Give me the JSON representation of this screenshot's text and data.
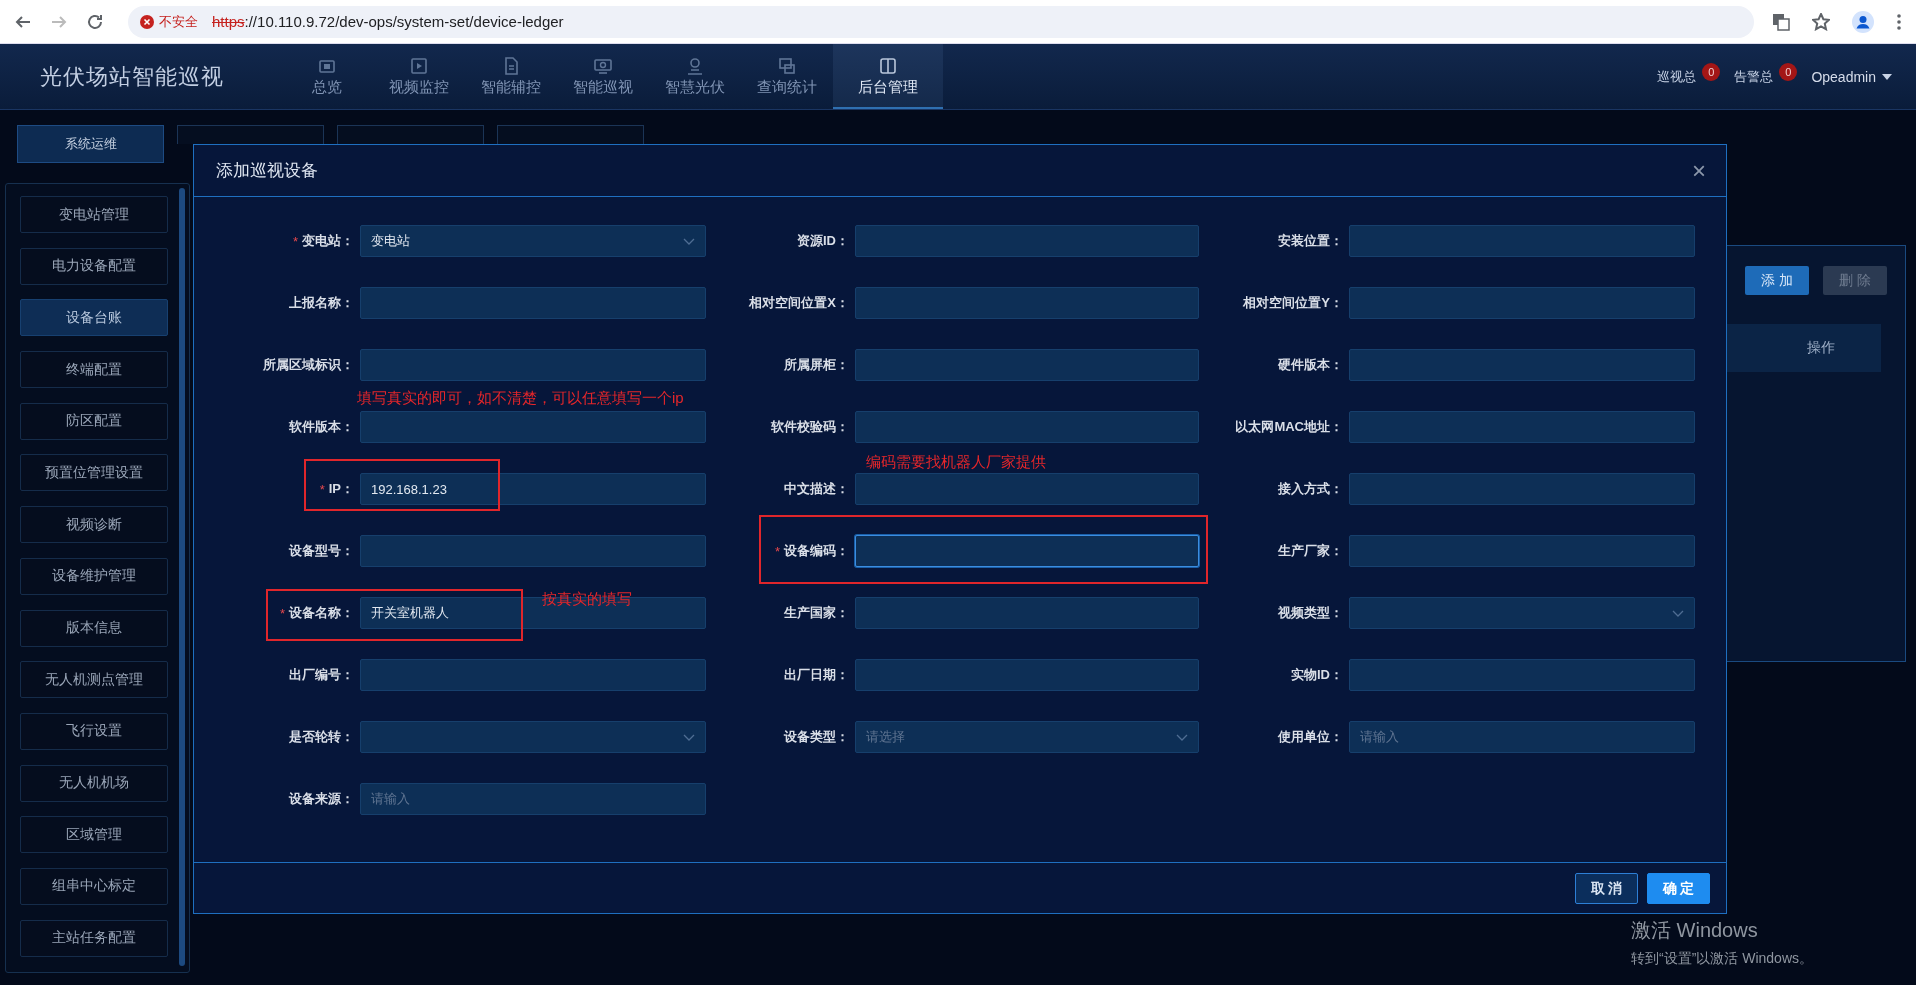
{
  "browser": {
    "security": "不安全",
    "url_scheme": "https",
    "url_rest": "://10.110.9.72/dev-ops/system-set/device-ledger"
  },
  "app": {
    "title": "光伏场站智能巡视",
    "nav": [
      {
        "label": "总览",
        "selected": false
      },
      {
        "label": "视频监控",
        "selected": false
      },
      {
        "label": "智能辅控",
        "selected": false
      },
      {
        "label": "智能巡视",
        "selected": false
      },
      {
        "label": "智慧光伏",
        "selected": false
      },
      {
        "label": "查询统计",
        "selected": false
      },
      {
        "label": "后台管理",
        "selected": true
      }
    ],
    "counters": [
      {
        "label": "巡视总",
        "count": "0"
      },
      {
        "label": "告警总",
        "count": "0"
      }
    ],
    "user": "Opeadmin"
  },
  "tabs": [
    {
      "label": "系统运维",
      "selected": true
    },
    {
      "selected": false
    },
    {
      "selected": false
    },
    {
      "selected": false
    }
  ],
  "sidebar": {
    "items": [
      {
        "label": "变电站管理",
        "selected": false
      },
      {
        "label": "电力设备配置",
        "selected": false
      },
      {
        "label": "设备台账",
        "selected": true
      },
      {
        "label": "终端配置",
        "selected": false
      },
      {
        "label": "防区配置",
        "selected": false
      },
      {
        "label": "预置位管理设置",
        "selected": false
      },
      {
        "label": "视频诊断",
        "selected": false
      },
      {
        "label": "设备维护管理",
        "selected": false
      },
      {
        "label": "版本信息",
        "selected": false
      },
      {
        "label": "无人机测点管理",
        "selected": false
      },
      {
        "label": "飞行设置",
        "selected": false
      },
      {
        "label": "无人机机场",
        "selected": false
      },
      {
        "label": "区域管理",
        "selected": false
      },
      {
        "label": "组串中心标定",
        "selected": false
      },
      {
        "label": "主站任务配置",
        "selected": false
      }
    ]
  },
  "panel": {
    "buttons": [
      {
        "label": "添 加",
        "disabled": false
      },
      {
        "label": "删 除",
        "disabled": true
      }
    ],
    "columns": [
      "操作"
    ]
  },
  "dialog": {
    "title": "添加巡视设备",
    "close": "×",
    "required_mark": "*",
    "fields": [
      {
        "label": "变电站：",
        "kind": "select",
        "value": "变电站",
        "required": true,
        "focused": false
      },
      {
        "label": "资源ID：",
        "kind": "input",
        "required": false,
        "focused": false
      },
      {
        "label": "安装位置：",
        "kind": "input",
        "required": false,
        "focused": false
      },
      {
        "label": "上报名称：",
        "kind": "input",
        "required": false,
        "focused": false
      },
      {
        "label": "相对空间位置X：",
        "kind": "input",
        "required": false,
        "focused": false
      },
      {
        "label": "相对空间位置Y：",
        "kind": "input",
        "required": false,
        "focused": false
      },
      {
        "label": "所属区域标识：",
        "kind": "input",
        "required": false,
        "focused": false
      },
      {
        "label": "所属屏柜：",
        "kind": "input",
        "required": false,
        "focused": false
      },
      {
        "label": "硬件版本：",
        "kind": "input",
        "required": false,
        "focused": false
      },
      {
        "label": "软件版本：",
        "kind": "input",
        "required": false,
        "focused": false
      },
      {
        "label": "软件校验码：",
        "kind": "input",
        "required": false,
        "focused": false
      },
      {
        "label": "以太网MAC地址：",
        "kind": "input",
        "required": false,
        "focused": false
      },
      {
        "label": "IP：",
        "kind": "input",
        "value": "192.168.1.23",
        "required": true,
        "focused": false
      },
      {
        "label": "中文描述：",
        "kind": "input",
        "required": false,
        "focused": false
      },
      {
        "label": "接入方式：",
        "kind": "input",
        "required": false,
        "focused": false
      },
      {
        "label": "设备型号：",
        "kind": "input",
        "required": false,
        "focused": false
      },
      {
        "label": "设备编码：",
        "kind": "input",
        "required": true,
        "focused": true
      },
      {
        "label": "生产厂家：",
        "kind": "input",
        "required": false,
        "focused": false
      },
      {
        "label": "设备名称：",
        "kind": "input",
        "value": "开关室机器人",
        "required": true,
        "focused": false
      },
      {
        "label": "生产国家：",
        "kind": "input",
        "required": false,
        "focused": false
      },
      {
        "label": "视频类型：",
        "kind": "select",
        "required": false,
        "focused": false
      },
      {
        "label": "出厂编号：",
        "kind": "input",
        "required": false,
        "focused": false
      },
      {
        "label": "出厂日期：",
        "kind": "input",
        "required": false,
        "focused": false
      },
      {
        "label": "实物ID：",
        "kind": "input",
        "required": false,
        "focused": false
      },
      {
        "label": "是否轮转：",
        "kind": "select",
        "required": false,
        "focused": false
      },
      {
        "label": "设备类型：",
        "kind": "select",
        "placeholder": "请选择",
        "required": false,
        "focused": false
      },
      {
        "label": "使用单位：",
        "kind": "input",
        "placeholder": "请输入",
        "required": false,
        "focused": false
      },
      {
        "label": "设备来源：",
        "kind": "input",
        "placeholder": "请输入",
        "required": false,
        "focused": false
      }
    ],
    "buttons": [
      {
        "label": "取 消",
        "kind": "secondary"
      },
      {
        "label": "确 定",
        "kind": "primary"
      }
    ],
    "annotations": [
      {
        "kind": "box"
      },
      {
        "kind": "box"
      },
      {
        "kind": "box"
      },
      {
        "kind": "note",
        "text": "填写真实的即可，如不清楚，可以任意填写一个ip"
      },
      {
        "kind": "note",
        "text": "编码需要找机器人厂家提供"
      },
      {
        "kind": "note",
        "text": "按真实的填写"
      }
    ]
  },
  "os_notice": {
    "title": "激活 Windows",
    "subtitle": "转到“设置”以激活 Windows。"
  }
}
